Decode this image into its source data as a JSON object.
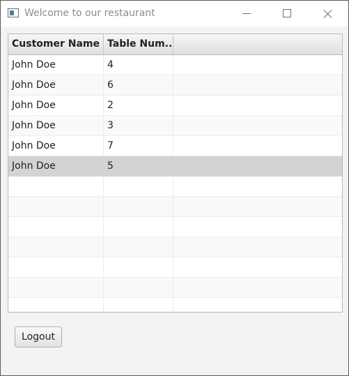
{
  "window": {
    "title": "Welcome to our restaurant",
    "icon": "app-window-icon",
    "controls": [
      "minimize-icon",
      "maximize-icon",
      "close-icon"
    ]
  },
  "table": {
    "columns": [
      "Customer Name",
      "Table Num..."
    ],
    "rows": [
      {
        "customer": "John Doe",
        "table": "4"
      },
      {
        "customer": "John Doe",
        "table": "6"
      },
      {
        "customer": "John Doe",
        "table": "2"
      },
      {
        "customer": "John Doe",
        "table": "3"
      },
      {
        "customer": "John Doe",
        "table": "7"
      },
      {
        "customer": "John Doe",
        "table": "5"
      }
    ],
    "selected_row_index": 5
  },
  "logout_label": "Logout",
  "colors": {
    "selection": "#d3d3d3",
    "window_background": "#f3f3f3",
    "header_gradient_top": "#f6f6f6",
    "header_gradient_bottom": "#e0e0e0"
  }
}
